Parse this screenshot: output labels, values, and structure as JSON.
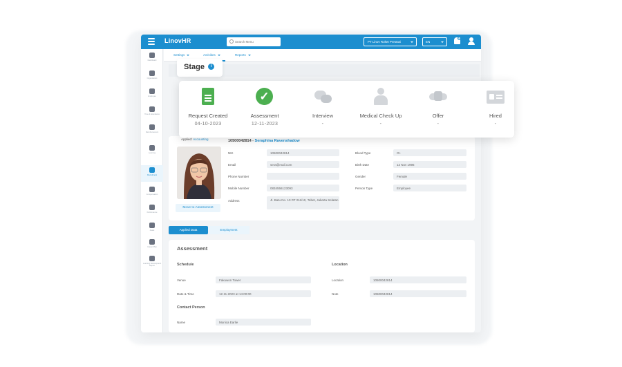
{
  "app": {
    "brand_prefix": "Linov",
    "brand_suffix": "HR"
  },
  "topbar": {
    "search_placeholder": "Search Menu",
    "company": "PT Linov Roket Prestasi",
    "language": "EN",
    "notification_count": "10"
  },
  "sidebar": {
    "items": [
      {
        "label": "Dashboard",
        "icon": "dashboard-icon"
      },
      {
        "label": "Organization",
        "icon": "org-icon"
      },
      {
        "label": "Employee",
        "icon": "employee-icon"
      },
      {
        "label": "Time & Attendance",
        "icon": "clock-icon"
      },
      {
        "label": "Reimbursement",
        "icon": "reimbursement-icon"
      },
      {
        "label": "Learning",
        "icon": "learning-icon"
      },
      {
        "label": "Recruitment",
        "icon": "recruitment-icon"
      },
      {
        "label": "Compensation",
        "icon": "compensation-icon"
      },
      {
        "label": "Performance",
        "icon": "performance-icon"
      },
      {
        "label": "Asset",
        "icon": "asset-icon"
      },
      {
        "label": "Career Plan",
        "icon": "career-icon"
      },
      {
        "label": "Learning Development Report",
        "icon": "ldr-icon"
      }
    ]
  },
  "subnav": {
    "settings": "Settings",
    "activities": "Activities",
    "reports": "Reports"
  },
  "stage": {
    "title": "Stage",
    "info": "i",
    "steps": [
      {
        "label": "Request Created",
        "date": "04-10-2023",
        "status": "done",
        "icon": "document-icon"
      },
      {
        "label": "Assessment",
        "date": "12-11-2023",
        "status": "done",
        "icon": "check-circle-icon"
      },
      {
        "label": "Interview",
        "date": "-",
        "status": "pending",
        "icon": "chat-bubbles-icon"
      },
      {
        "label": "Medical Check Up",
        "date": "-",
        "status": "pending",
        "icon": "doctor-icon"
      },
      {
        "label": "Offer",
        "date": "-",
        "status": "pending",
        "icon": "handshake-icon"
      },
      {
        "label": "Hired",
        "date": "-",
        "status": "pending",
        "icon": "id-card-icon"
      }
    ]
  },
  "candidate": {
    "applied_label": "Applied:",
    "applied_value": "Accounting",
    "id": "10500042814",
    "separator": " - ",
    "name": "Seraphina Ravenshadow",
    "move_button": "Move to Assessment",
    "fields_left": [
      {
        "label": "NIK",
        "value": "10500042814"
      },
      {
        "label": "Email",
        "value": "sera@mail.com"
      },
      {
        "label": "Phone Number",
        "value": ""
      },
      {
        "label": "Mobile Number",
        "value": "0834556123093"
      },
      {
        "label": "Address",
        "value": "Jl. Batu No. 10 RT 011/10, Tebet, Jakarta Selatan"
      }
    ],
    "fields_right": [
      {
        "label": "Blood Type",
        "value": "O+"
      },
      {
        "label": "Birth Date",
        "value": "12 Nov 1996"
      },
      {
        "label": "Gender",
        "value": "Female"
      },
      {
        "label": "Person Type",
        "value": "Employee"
      }
    ]
  },
  "tabs": {
    "active": "Applied Data",
    "inactive": "Employment"
  },
  "assessment": {
    "title": "Assessment",
    "schedule_title": "Schedule",
    "location_title": "Location",
    "contact_title": "Contact Person",
    "venue_label": "Venue",
    "venue_value": "Fakuwon Tower",
    "datetime_label": "Date & Time",
    "datetime_value": "12-11-2023 at 14:00:00",
    "location_label": "Location",
    "location_value": "10500042814",
    "note_label": "Note",
    "note_value": "10500042814",
    "name_label": "Name",
    "name_value": "Monica Earlie"
  }
}
